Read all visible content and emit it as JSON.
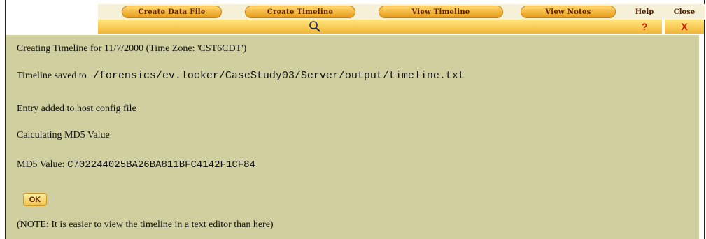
{
  "toolbar": {
    "buttons": [
      "Create Data File",
      "Create Timeline",
      "View Timeline",
      "View Notes"
    ],
    "help_label": "Help",
    "close_label": "Close",
    "help_icon": "?",
    "close_icon": "X"
  },
  "content": {
    "line1": "Creating Timeline for 11/7/2000 (Time Zone: 'CST6CDT')",
    "line2_prefix": "Timeline saved to",
    "line2_path": " /forensics/ev.locker/CaseStudy03/Server/output/timeline.txt",
    "line3": "Entry added to host config file",
    "line4": "Calculating MD5 Value",
    "line5_prefix": "MD5 Value: ",
    "line5_value": "C702244025BA26BA811BFC4142F1CF84",
    "ok_label": "OK",
    "note": "(NOTE: It is easier to view the timeline in a text editor than here)"
  },
  "colors": {
    "content_background": "#cfcfa0",
    "toolbar_gold": "#f2b536",
    "toolbar_text": "#5a1f00",
    "icon_red": "#cc1b00"
  },
  "icons": [
    "search-icon",
    "help-icon",
    "close-icon"
  ]
}
